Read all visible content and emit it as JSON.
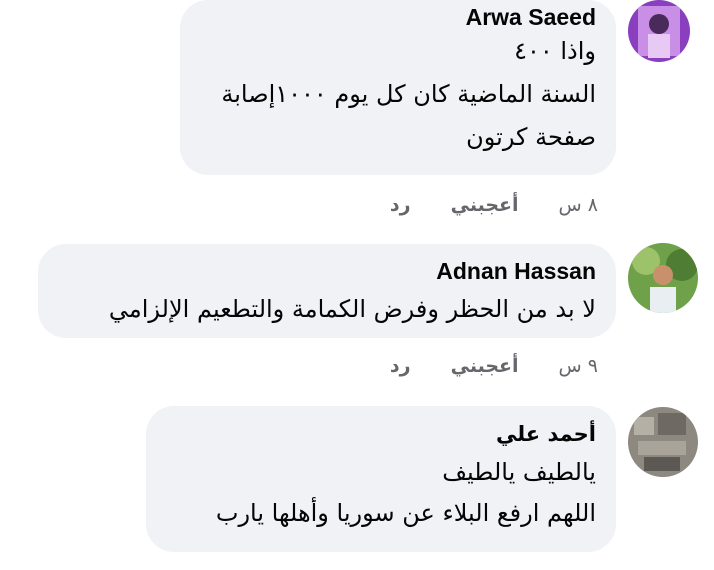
{
  "comments": [
    {
      "author": "Arwa Saeed",
      "lines": [
        "واذا ٤٠٠",
        "السنة الماضية كان كل يوم ١٠٠٠إصابة",
        "صفحة كرتون"
      ],
      "time": "٨ س",
      "like": "أعجبني",
      "reply": "رد"
    },
    {
      "author": "Adnan Hassan",
      "lines": [
        "لا بد من الحظر وفرض الكمامة والتطعيم الإلزامي"
      ],
      "time": "٩ س",
      "like": "أعجبني",
      "reply": "رد"
    },
    {
      "author": "أحمد علي",
      "lines": [
        "يالطيف يالطيف",
        "اللهم ارفع البلاء عن سوريا وأهلها يارب"
      ]
    }
  ],
  "colors": {
    "bubble": "#f0f2f5",
    "text": "#050505",
    "meta": "#65676b"
  }
}
